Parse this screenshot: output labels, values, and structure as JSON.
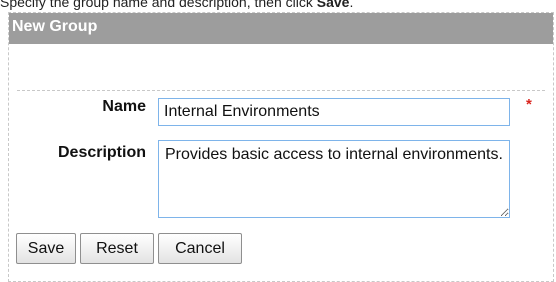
{
  "instruction": {
    "prefix": "Specify the group name and description, then click ",
    "action": "Save",
    "suffix": "."
  },
  "panel": {
    "title": "New Group"
  },
  "form": {
    "name_label": "Name",
    "name_value": "Internal Environments",
    "required_marker": "*",
    "description_label": "Description",
    "description_value": "Provides basic access to internal environments."
  },
  "buttons": {
    "save": "Save",
    "reset": "Reset",
    "cancel": "Cancel"
  },
  "colors": {
    "header_bg": "#9d9d9d",
    "required": "#d9241e",
    "input_border": "#7eb4ea"
  }
}
